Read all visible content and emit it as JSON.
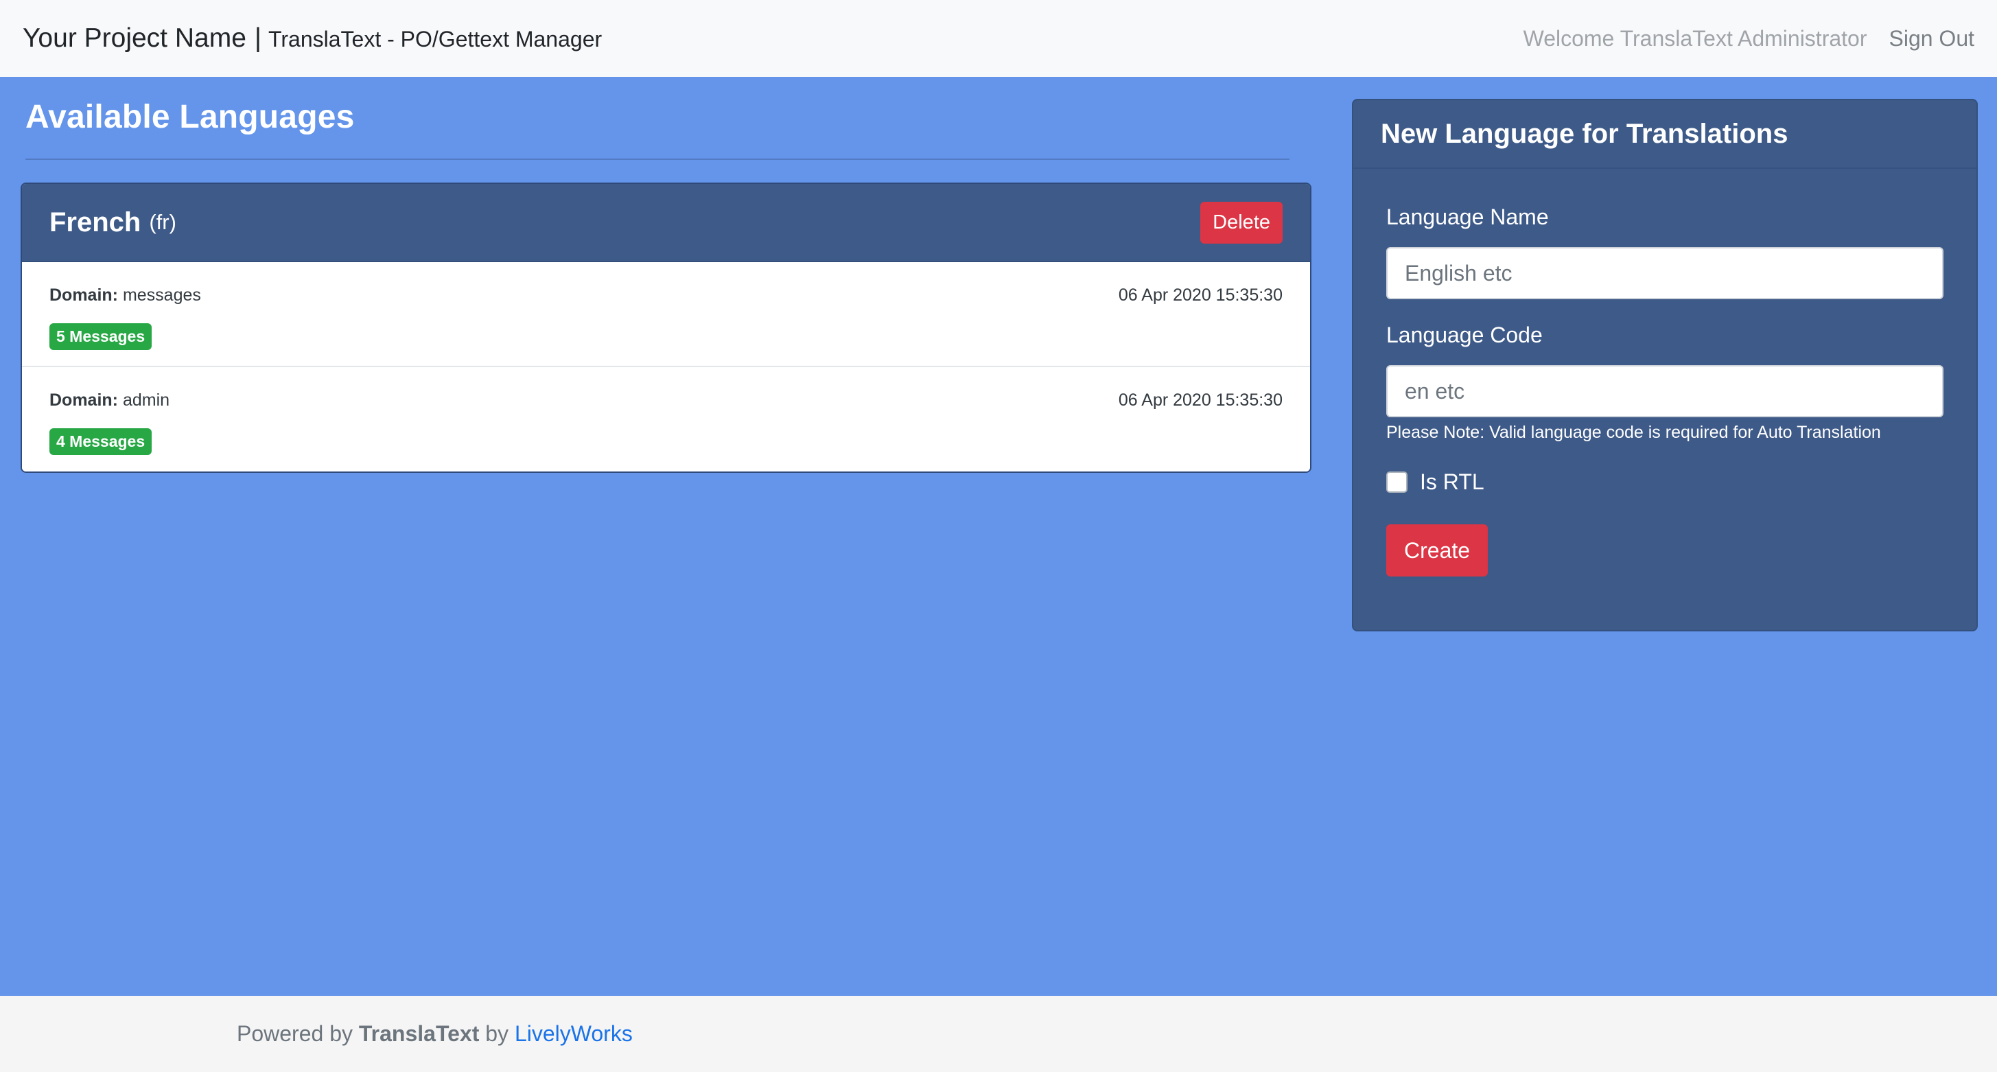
{
  "navbar": {
    "project_name": "Your Project Name",
    "separator": "|",
    "app_name": "TranslaText - PO/Gettext Manager",
    "welcome": "Welcome TranslaText Administrator",
    "signout": "Sign Out"
  },
  "main": {
    "title": "Available Languages",
    "languages": [
      {
        "name": "French",
        "code": "(fr)",
        "delete_label": "Delete",
        "domains": [
          {
            "label": "Domain:",
            "name": "messages",
            "date": "06 Apr 2020 15:35:30",
            "badge": "5 Messages"
          },
          {
            "label": "Domain:",
            "name": "admin",
            "date": "06 Apr 2020 15:35:30",
            "badge": "4 Messages"
          }
        ]
      }
    ]
  },
  "form": {
    "title": "New Language for Translations",
    "name_label": "Language Name",
    "name_placeholder": "English etc",
    "name_value": "",
    "code_label": "Language Code",
    "code_placeholder": "en etc",
    "code_value": "",
    "note": "Please Note: Valid language code is required for Auto Translation",
    "rtl_label": "Is RTL",
    "rtl_checked": false,
    "create_label": "Create"
  },
  "footer": {
    "prefix": "Powered by",
    "brand": "TranslaText",
    "by": "by",
    "link": "LivelyWorks"
  },
  "colors": {
    "page_bg": "#6495ea",
    "card_header": "#3e5a88",
    "danger": "#dc3545",
    "success": "#28a745",
    "link": "#1a73e8"
  }
}
